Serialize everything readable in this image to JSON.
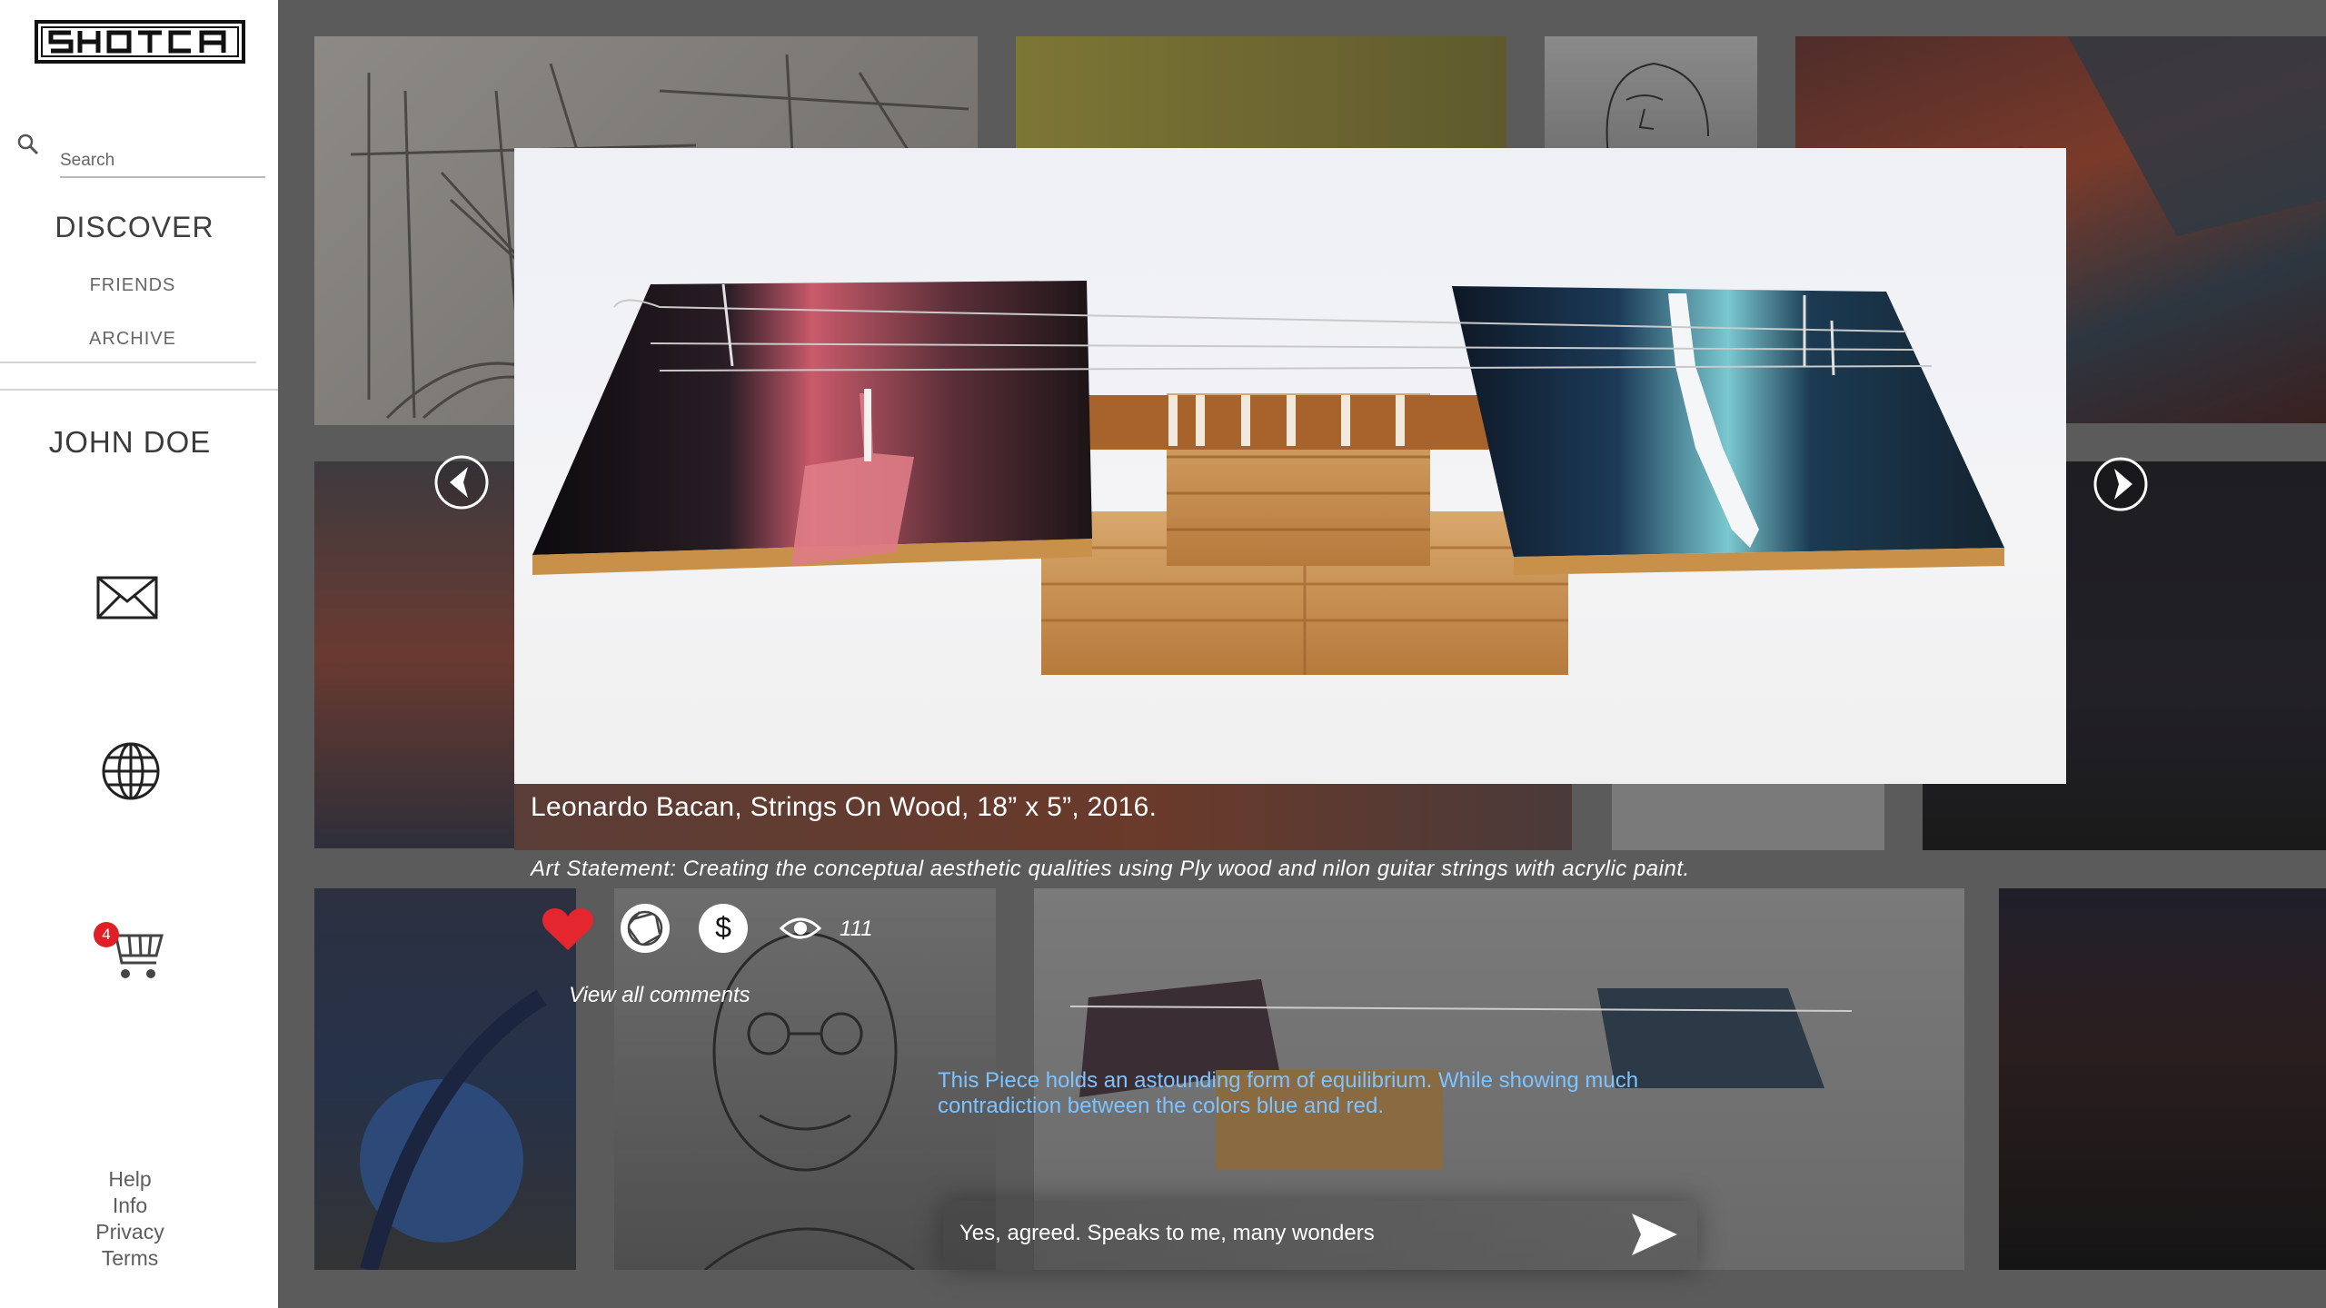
{
  "app": {
    "logo_text": "SHOTCA"
  },
  "sidebar": {
    "search": {
      "placeholder": "Search"
    },
    "nav": {
      "discover": "DISCOVER",
      "friends": "FRIENDS",
      "archive": "ARCHIVE"
    },
    "user_name": "JOHN DOE",
    "icons": {
      "messages": "mail-icon",
      "explore": "globe-icon",
      "cart": "cart-icon"
    },
    "cart_count": "4",
    "footer": [
      "Help",
      "Info",
      "Privacy",
      "Terms"
    ]
  },
  "artwork": {
    "caption": "Leonardo Bacan, Strings On Wood, 18” x 5”, 2016.",
    "statement": "Art Statement: Creating the conceptual aesthetic qualities using Ply wood and nilon guitar strings with acrylic paint.",
    "views": "111",
    "view_comments_label": "View all comments",
    "icons": {
      "like": "heart-icon",
      "aperture": "aperture-icon",
      "price": "dollar-icon",
      "views": "eye-icon",
      "prev": "chevron-left-icon",
      "next": "chevron-right-icon"
    }
  },
  "comment": {
    "text": "This Piece holds an astounding form of equilibrium.  While showing much contradiction between the colors blue and red."
  },
  "reply": {
    "value": "Yes, agreed. Speaks to me, many wonders",
    "send_icon": "send-icon"
  },
  "colors": {
    "accent_heart": "#e4262f",
    "comment_text": "#7ec3ff",
    "badge": "#e01f26",
    "overlay": "#5b5b5b"
  }
}
